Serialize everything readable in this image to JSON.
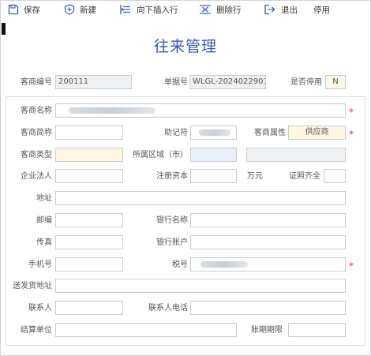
{
  "toolbar": {
    "save": "保存",
    "new": "新建",
    "insert_row": "向下插入行",
    "delete_row": "删除行",
    "exit": "退出",
    "disable": "停用"
  },
  "page_title": "往来管理",
  "header": {
    "customer_code_label": "客商编号",
    "customer_code_value": "200111",
    "doc_no_label": "单据号",
    "doc_no_value": "WLGL-2024022901",
    "disabled_label": "是否停用",
    "disabled_value": "N"
  },
  "form": {
    "name_label": "客商名称",
    "short_label": "客商简称",
    "mnemonic_label": "助记符",
    "attr_label": "客商属性",
    "attr_value": "供应商",
    "type_label": "客商类型",
    "region_label": "所属区域（市）",
    "legal_label": "企业法人",
    "capital_label": "注册资本",
    "capital_unit": "万元",
    "cert_label": "证照齐全",
    "address_label": "地址",
    "postcode_label": "邮编",
    "bank_label": "银行名称",
    "fax_label": "传真",
    "account_label": "银行账户",
    "mobile_label": "手机号",
    "tax_label": "税号",
    "ship_address_label": "送发货地址",
    "contact_label": "联系人",
    "contact_phone_label": "联系人电话",
    "settle_label": "结算单位",
    "term_label": "账期期限",
    "required_mark": "*"
  }
}
